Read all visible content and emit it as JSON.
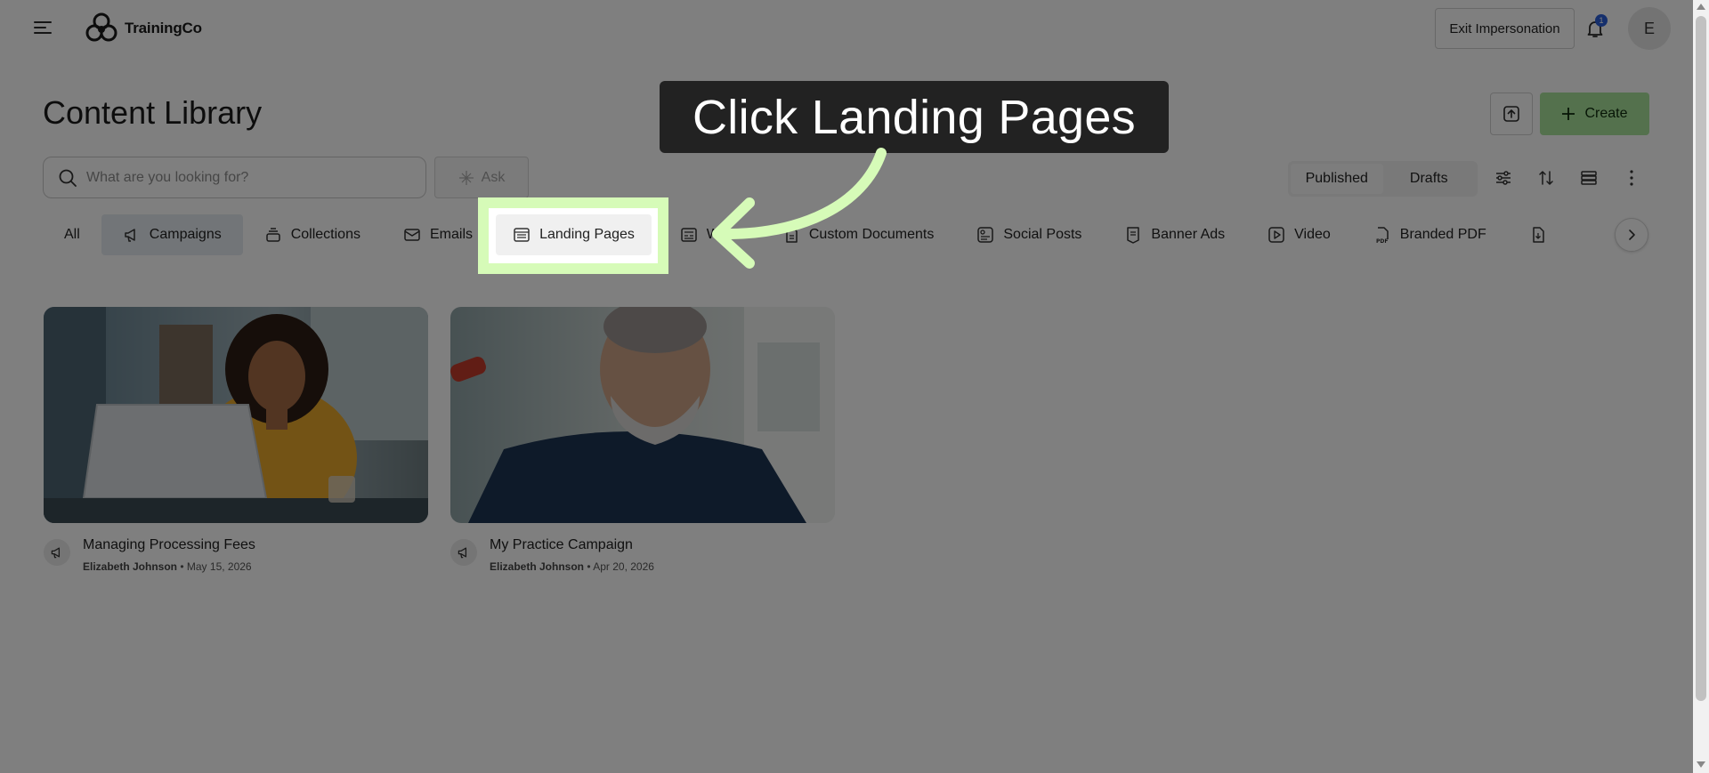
{
  "header": {
    "brand": "TrainingCo",
    "exit_label": "Exit Impersonation",
    "notification_count": "1",
    "avatar_initial": "E"
  },
  "page": {
    "title": "Content Library",
    "create_label": "Create",
    "search_placeholder": "What are you looking for?",
    "ask_label": "Ask"
  },
  "status_toggle": {
    "published": "Published",
    "drafts": "Drafts",
    "active": "Published"
  },
  "tabs": [
    {
      "label": "All",
      "icon": "none"
    },
    {
      "label": "Campaigns",
      "icon": "megaphone-icon"
    },
    {
      "label": "Collections",
      "icon": "stack-icon"
    },
    {
      "label": "Emails",
      "icon": "mail-icon"
    },
    {
      "label": "Landing Pages",
      "icon": "browser-page-icon"
    },
    {
      "label": "W",
      "icon": "id-card-icon"
    },
    {
      "label": "Custom Documents",
      "icon": "document-icon"
    },
    {
      "label": "Social Posts",
      "icon": "social-post-icon"
    },
    {
      "label": "Banner Ads",
      "icon": "banner-icon"
    },
    {
      "label": "Video",
      "icon": "play-icon"
    },
    {
      "label": "Branded PDF",
      "icon": "pdf-icon"
    }
  ],
  "cards": [
    {
      "title": "Managing Processing Fees",
      "author": "Elizabeth Johnson",
      "date": "May 15, 2026",
      "type_icon": "megaphone-icon"
    },
    {
      "title": "My Practice Campaign",
      "author": "Elizabeth Johnson",
      "date": "Apr 20, 2026",
      "type_icon": "megaphone-icon"
    }
  ],
  "annotation": {
    "callout_text": "Click Landing Pages",
    "highlight_color": "#d6fbb8"
  },
  "colors": {
    "create_green": "#a8e39a",
    "selected_tab": "#e5eaf0",
    "badge_blue": "#2b5fd9"
  }
}
